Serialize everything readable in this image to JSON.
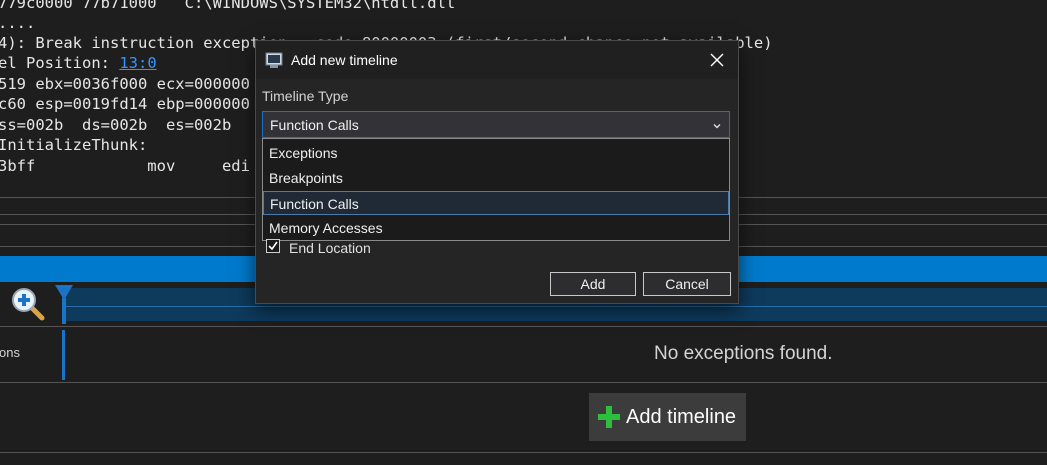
{
  "console": {
    "lines": [
      "779c0000 77b71000   C:\\WINDOWS\\SYSTEM32\\ntdll.dll",
      "....",
      "4): Break instruction exception - code 80000003 (first/second chance not available)",
      "",
      "519 ebx=0036f000 ecx=000000",
      "c60 esp=0019fd14 ebp=000000",
      "ss=002b  ds=002b  es=002b",
      "InitializeThunk:",
      "3bff            mov     edi"
    ],
    "position_prefix": "el Position: ",
    "position_link": "13:0"
  },
  "timeline": {
    "row_label": "ons",
    "empty_message": "No exceptions found.",
    "add_timeline_label": "Add timeline"
  },
  "dialog": {
    "title": "Add new timeline",
    "timeline_type_label": "Timeline Type",
    "selected_value": "Function Calls",
    "options": [
      "Exceptions",
      "Breakpoints",
      "Function Calls",
      "Memory Accesses"
    ],
    "end_location_label": "End Location",
    "end_location_checked": true,
    "add_label": "Add",
    "cancel_label": "Cancel"
  },
  "colors": {
    "accent": "#007acc",
    "background": "#1e1e1e",
    "plus_green": "#2dbf3c"
  },
  "icons": [
    "app-icon",
    "close-icon",
    "chevron-down-icon",
    "zoom-in-icon",
    "position-marker-icon",
    "plus-icon",
    "checkmark-icon"
  ]
}
